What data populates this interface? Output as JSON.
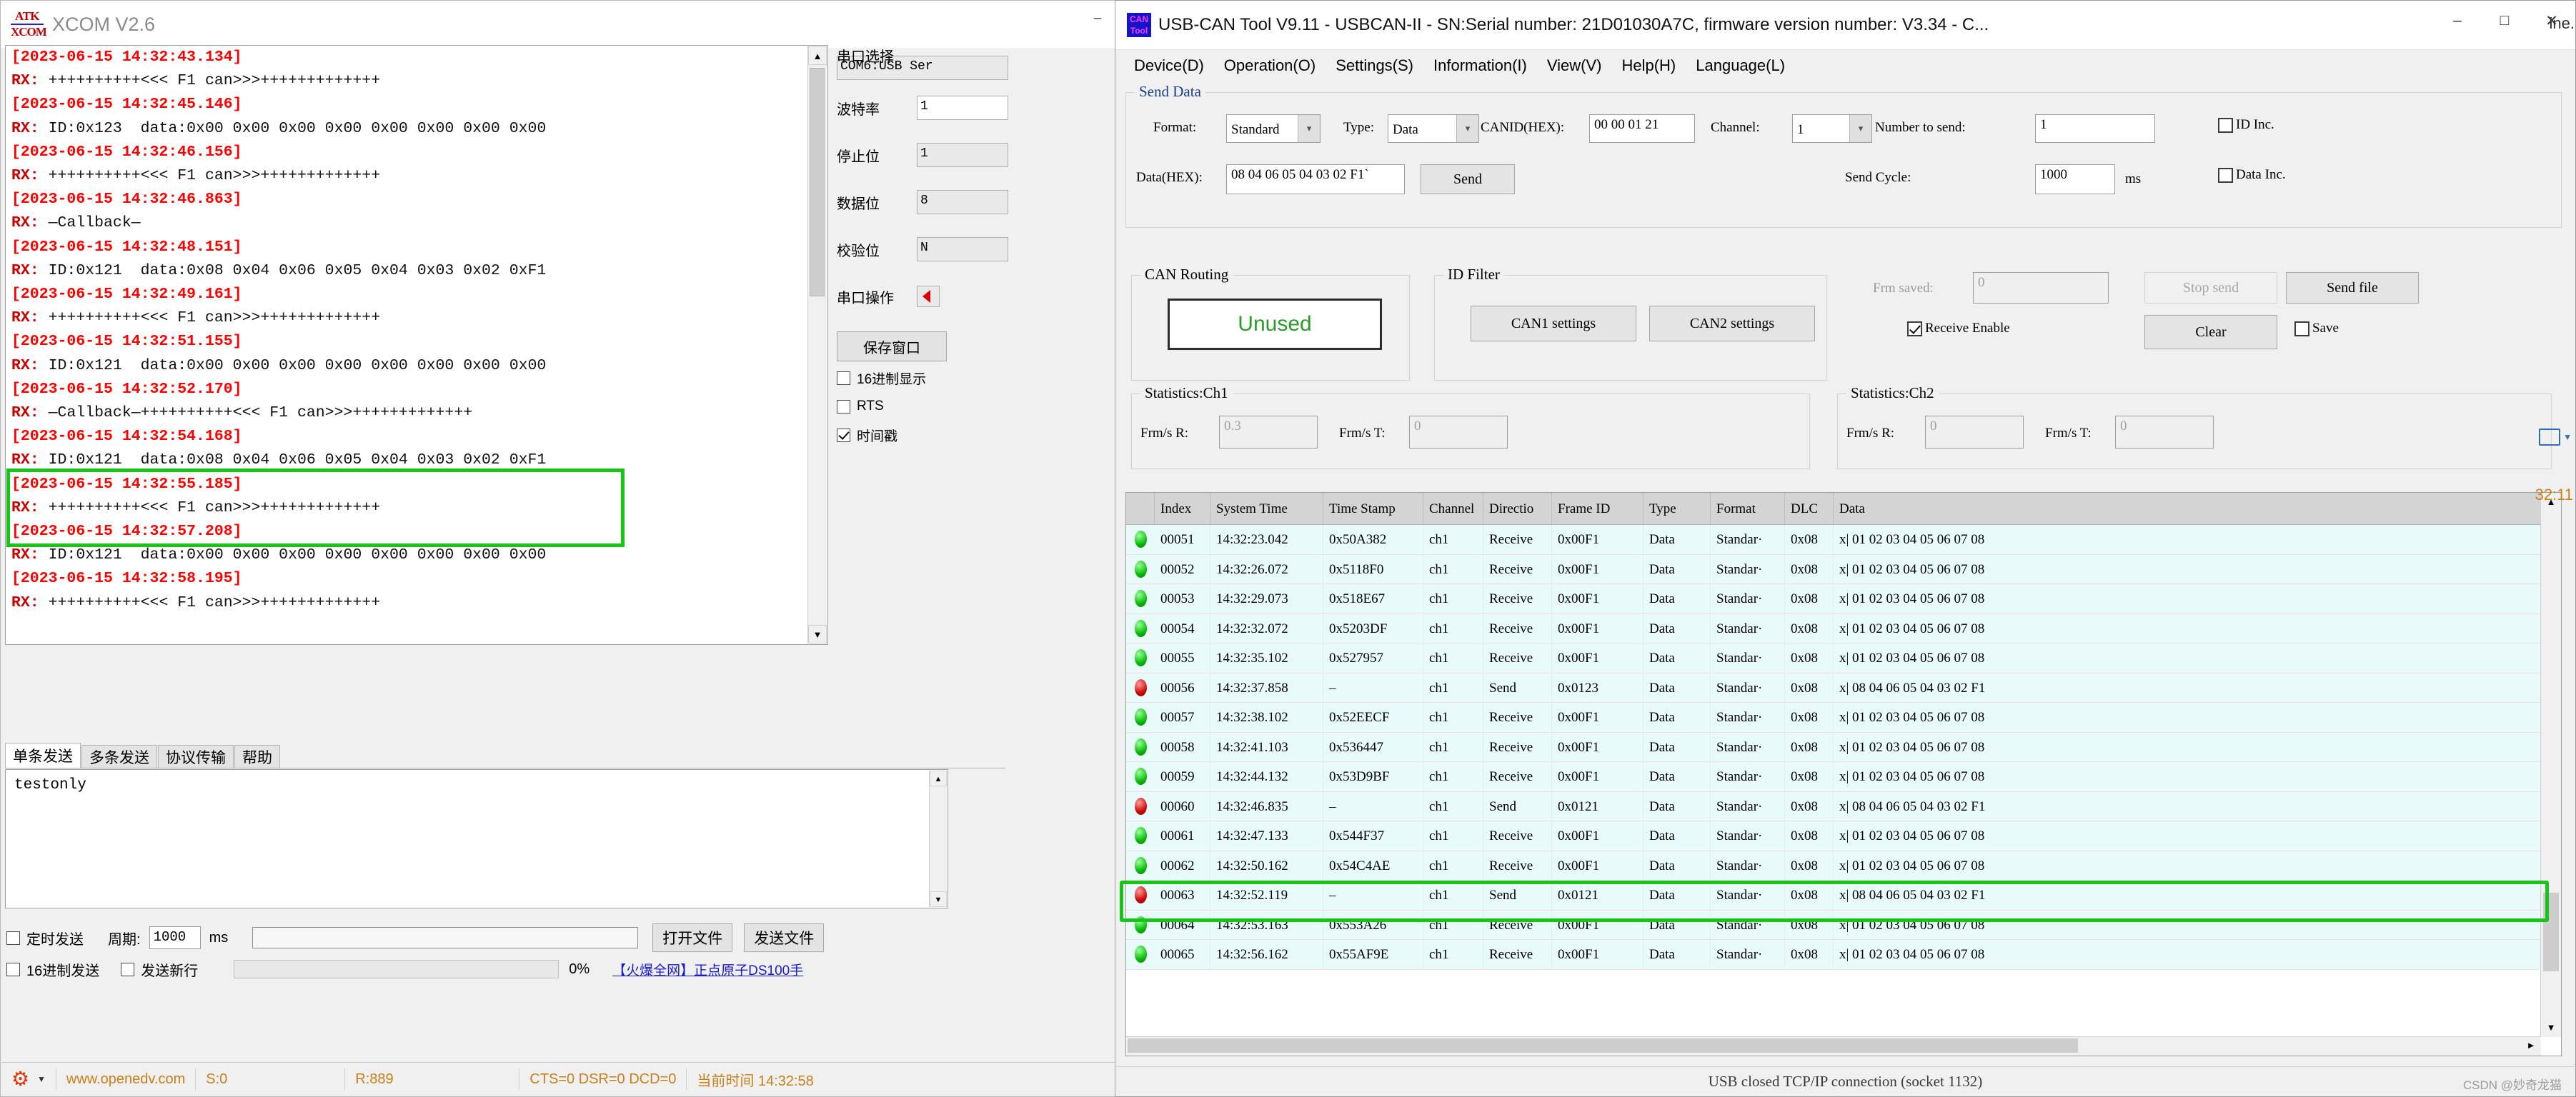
{
  "xcom": {
    "title": "XCOM V2.6",
    "logo_line1": "ATK",
    "logo_line2": "XCOM",
    "window_buttons": [
      "–",
      "□",
      "✕"
    ],
    "log_lines": [
      {
        "type": "ts",
        "text": "[2023-06-15 14:32:43.134]"
      },
      {
        "type": "rx",
        "text": "RX: ++++++++++<<< F1 can>>>+++++++++++++"
      },
      {
        "type": "ts",
        "text": "[2023-06-15 14:32:45.146]"
      },
      {
        "type": "rx",
        "text": "RX: ID:0x123  data:0x00 0x00 0x00 0x00 0x00 0x00 0x00 0x00"
      },
      {
        "type": "ts",
        "text": "[2023-06-15 14:32:46.156]"
      },
      {
        "type": "rx",
        "text": "RX: ++++++++++<<< F1 can>>>+++++++++++++"
      },
      {
        "type": "ts",
        "text": "[2023-06-15 14:32:46.863]"
      },
      {
        "type": "rx",
        "text": "RX: —Callback—"
      },
      {
        "type": "ts",
        "text": "[2023-06-15 14:32:48.151]"
      },
      {
        "type": "rx",
        "text": "RX: ID:0x121  data:0x08 0x04 0x06 0x05 0x04 0x03 0x02 0xF1"
      },
      {
        "type": "ts",
        "text": "[2023-06-15 14:32:49.161]"
      },
      {
        "type": "rx",
        "text": "RX: ++++++++++<<< F1 can>>>+++++++++++++"
      },
      {
        "type": "ts",
        "text": "[2023-06-15 14:32:51.155]"
      },
      {
        "type": "rx",
        "text": "RX: ID:0x121  data:0x00 0x00 0x00 0x00 0x00 0x00 0x00 0x00"
      },
      {
        "type": "ts",
        "text": "[2023-06-15 14:32:52.170]"
      },
      {
        "type": "rx",
        "text": "RX: —Callback—++++++++++<<< F1 can>>>+++++++++++++"
      },
      {
        "type": "ts",
        "text": "[2023-06-15 14:32:54.168]"
      },
      {
        "type": "rx",
        "text": "RX: ID:0x121  data:0x08 0x04 0x06 0x05 0x04 0x03 0x02 0xF1"
      },
      {
        "type": "ts",
        "text": "[2023-06-15 14:32:55.185]"
      },
      {
        "type": "rx",
        "text": "RX: ++++++++++<<< F1 can>>>+++++++++++++"
      },
      {
        "type": "ts",
        "text": "[2023-06-15 14:32:57.208]"
      },
      {
        "type": "rx",
        "text": "RX: ID:0x121  data:0x00 0x00 0x00 0x00 0x00 0x00 0x00 0x00"
      },
      {
        "type": "ts",
        "text": "[2023-06-15 14:32:58.195]"
      },
      {
        "type": "rx",
        "text": "RX: ++++++++++<<< F1 can>>>+++++++++++++"
      }
    ],
    "settings": {
      "port_select_label": "串口选择",
      "port_value": "COM6:USB Ser",
      "baud_label": "波特率",
      "baud_value": "1",
      "stopbits_label": "停止位",
      "stopbits_value": "1",
      "databits_label": "数据位",
      "databits_value": "8",
      "parity_label": "校验位",
      "parity_value": "N",
      "operation_label": "串口操作",
      "save_window_button": "保存窗口",
      "hex_display_label": "16进制显示",
      "rts_label": "RTS",
      "timestamp_label": "时间戳",
      "hex_display_checked": false,
      "rts_checked": false,
      "timestamp_checked": true
    },
    "tabs": [
      {
        "label": "单条发送",
        "active": true
      },
      {
        "label": "多条发送",
        "active": false
      },
      {
        "label": "协议传输",
        "active": false
      },
      {
        "label": "帮助",
        "active": false
      }
    ],
    "send_text": "testonly",
    "options": {
      "timed_send_label": "定时发送",
      "timed_send_checked": false,
      "period_label": "周期:",
      "period_value": "1000",
      "period_unit": "ms",
      "hex_send_label": "16进制发送",
      "hex_send_checked": false,
      "newline_send_label": "发送新行",
      "newline_send_checked": false,
      "open_file_button": "打开文件",
      "send_file_button": "发送文件",
      "progress_text": "0%",
      "ad_text": "【火爆全网】正点原子DS100手"
    },
    "status": {
      "site": "www.openedv.com",
      "sent": "S:0",
      "received": "R:889",
      "lines": "CTS=0 DSR=0 DCD=0",
      "time": "当前时间 14:32:58"
    }
  },
  "can": {
    "title": "USB-CAN Tool V9.11 - USBCAN-II - SN:Serial number: 21D01030A7C, firmware version number: V3.34 - C...",
    "logo_a": "CAN",
    "logo_b": "Tool",
    "window_buttons": [
      "–",
      "□",
      "✕"
    ],
    "menu": [
      "Device(D)",
      "Operation(O)",
      "Settings(S)",
      "Information(I)",
      "View(V)",
      "Help(H)",
      "Language(L)"
    ],
    "send_data": {
      "group_title": "Send Data",
      "format_label": "Format:",
      "format_value": "Standard",
      "type_label": "Type:",
      "type_value": "Data",
      "canid_label": "CANID(HEX):",
      "canid_value": "00 00 01 21",
      "channel_label": "Channel:",
      "channel_value": "1",
      "number_label": "Number to send:",
      "number_value": "1",
      "id_inc_label": "ID Inc.",
      "id_inc_checked": false,
      "data_label": "Data(HEX):",
      "data_value": "08 04 06 05 04 03 02 F1`",
      "send_button": "Send",
      "send_cycle_label": "Send Cycle:",
      "send_cycle_value": "1000",
      "send_cycle_unit": "ms",
      "data_inc_label": "Data Inc.",
      "data_inc_checked": false
    },
    "can_routing": {
      "group_title": "CAN Routing",
      "status": "Unused",
      "status_color": "#2a9a2a"
    },
    "id_filter": {
      "group_title": "ID Filter",
      "can1_button": "CAN1 settings",
      "can2_button": "CAN2 settings"
    },
    "right_controls": {
      "frm_saved_label": "Frm saved:",
      "frm_saved_value": "0",
      "stop_send_button": "Stop send",
      "send_file_button": "Send file",
      "receive_enable_label": "Receive Enable",
      "receive_enable_checked": true,
      "clear_button": "Clear",
      "save_label": "Save",
      "save_checked": false
    },
    "stats_ch1": {
      "group_title": "Statistics:Ch1",
      "frm_r_label": "Frm/s R:",
      "frm_r_value": "0.3",
      "frm_t_label": "Frm/s T:",
      "frm_t_value": "0"
    },
    "stats_ch2": {
      "group_title": "Statistics:Ch2",
      "frm_r_label": "Frm/s R:",
      "frm_r_value": "0",
      "frm_t_label": "Frm/s T:",
      "frm_t_value": "0"
    },
    "table": {
      "columns": [
        "",
        "Index",
        "System Time",
        "Time Stamp",
        "Channel",
        "Directio",
        "Frame ID",
        "Type",
        "Format",
        "DLC",
        "Data"
      ],
      "rows": [
        {
          "dot": "green",
          "index": "00051",
          "system_time": "14:32:23.042",
          "time_stamp": "0x50A382",
          "channel": "ch1",
          "direction": "Receive",
          "frame_id": "0x00F1",
          "type": "Data",
          "format": "Standar·",
          "dlc": "0x08",
          "data": "x| 01 02 03 04 05 06 07 08"
        },
        {
          "dot": "green",
          "index": "00052",
          "system_time": "14:32:26.072",
          "time_stamp": "0x5118F0",
          "channel": "ch1",
          "direction": "Receive",
          "frame_id": "0x00F1",
          "type": "Data",
          "format": "Standar·",
          "dlc": "0x08",
          "data": "x| 01 02 03 04 05 06 07 08"
        },
        {
          "dot": "green",
          "index": "00053",
          "system_time": "14:32:29.073",
          "time_stamp": "0x518E67",
          "channel": "ch1",
          "direction": "Receive",
          "frame_id": "0x00F1",
          "type": "Data",
          "format": "Standar·",
          "dlc": "0x08",
          "data": "x| 01 02 03 04 05 06 07 08"
        },
        {
          "dot": "green",
          "index": "00054",
          "system_time": "14:32:32.072",
          "time_stamp": "0x5203DF",
          "channel": "ch1",
          "direction": "Receive",
          "frame_id": "0x00F1",
          "type": "Data",
          "format": "Standar·",
          "dlc": "0x08",
          "data": "x| 01 02 03 04 05 06 07 08"
        },
        {
          "dot": "green",
          "index": "00055",
          "system_time": "14:32:35.102",
          "time_stamp": "0x527957",
          "channel": "ch1",
          "direction": "Receive",
          "frame_id": "0x00F1",
          "type": "Data",
          "format": "Standar·",
          "dlc": "0x08",
          "data": "x| 01 02 03 04 05 06 07 08"
        },
        {
          "dot": "red",
          "index": "00056",
          "system_time": "14:32:37.858",
          "time_stamp": "–",
          "channel": "ch1",
          "direction": "Send",
          "frame_id": "0x0123",
          "type": "Data",
          "format": "Standar·",
          "dlc": "0x08",
          "data": "x| 08 04 06 05 04 03 02 F1"
        },
        {
          "dot": "green",
          "index": "00057",
          "system_time": "14:32:38.102",
          "time_stamp": "0x52EECF",
          "channel": "ch1",
          "direction": "Receive",
          "frame_id": "0x00F1",
          "type": "Data",
          "format": "Standar·",
          "dlc": "0x08",
          "data": "x| 01 02 03 04 05 06 07 08"
        },
        {
          "dot": "green",
          "index": "00058",
          "system_time": "14:32:41.103",
          "time_stamp": "0x536447",
          "channel": "ch1",
          "direction": "Receive",
          "frame_id": "0x00F1",
          "type": "Data",
          "format": "Standar·",
          "dlc": "0x08",
          "data": "x| 01 02 03 04 05 06 07 08"
        },
        {
          "dot": "green",
          "index": "00059",
          "system_time": "14:32:44.132",
          "time_stamp": "0x53D9BF",
          "channel": "ch1",
          "direction": "Receive",
          "frame_id": "0x00F1",
          "type": "Data",
          "format": "Standar·",
          "dlc": "0x08",
          "data": "x| 01 02 03 04 05 06 07 08"
        },
        {
          "dot": "red",
          "index": "00060",
          "system_time": "14:32:46.835",
          "time_stamp": "–",
          "channel": "ch1",
          "direction": "Send",
          "frame_id": "0x0121",
          "type": "Data",
          "format": "Standar·",
          "dlc": "0x08",
          "data": "x| 08 04 06 05 04 03 02 F1"
        },
        {
          "dot": "green",
          "index": "00061",
          "system_time": "14:32:47.133",
          "time_stamp": "0x544F37",
          "channel": "ch1",
          "direction": "Receive",
          "frame_id": "0x00F1",
          "type": "Data",
          "format": "Standar·",
          "dlc": "0x08",
          "data": "x| 01 02 03 04 05 06 07 08"
        },
        {
          "dot": "green",
          "index": "00062",
          "system_time": "14:32:50.162",
          "time_stamp": "0x54C4AE",
          "channel": "ch1",
          "direction": "Receive",
          "frame_id": "0x00F1",
          "type": "Data",
          "format": "Standar·",
          "dlc": "0x08",
          "data": "x| 01 02 03 04 05 06 07 08"
        },
        {
          "dot": "red",
          "index": "00063",
          "system_time": "14:32:52.119",
          "time_stamp": "–",
          "channel": "ch1",
          "direction": "Send",
          "frame_id": "0x0121",
          "type": "Data",
          "format": "Standar·",
          "dlc": "0x08",
          "data": "x| 08 04 06 05 04 03 02 F1"
        },
        {
          "dot": "green",
          "index": "00064",
          "system_time": "14:32:53.163",
          "time_stamp": "0x553A26",
          "channel": "ch1",
          "direction": "Receive",
          "frame_id": "0x00F1",
          "type": "Data",
          "format": "Standar·",
          "dlc": "0x08",
          "data": "x| 01 02 03 04 05 06 07 08"
        },
        {
          "dot": "green",
          "index": "00065",
          "system_time": "14:32:56.162",
          "time_stamp": "0x55AF9E",
          "channel": "ch1",
          "direction": "Receive",
          "frame_id": "0x00F1",
          "type": "Data",
          "format": "Standar·",
          "dlc": "0x08",
          "data": "x| 01 02 03 04 05 06 07 08"
        }
      ]
    },
    "status_bar": "USB closed TCP/IP connection (socket 1132)"
  },
  "desktop": {
    "tray_time": "32:11",
    "right_edge_text": "ine.",
    "watermark": "CSDN @妙奇龙猫"
  }
}
